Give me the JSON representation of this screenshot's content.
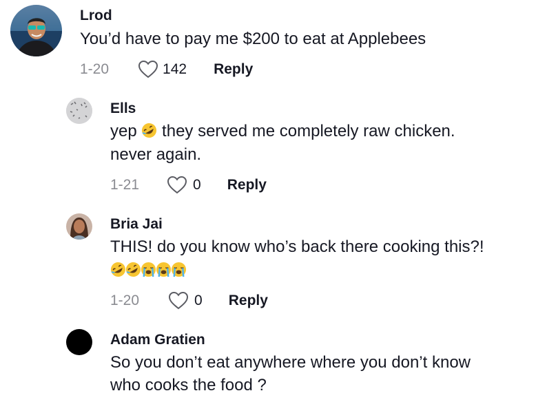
{
  "comments": [
    {
      "username": "Lrod",
      "text": "You’d have to pay me $200 to eat at Applebees",
      "date": "1-20",
      "likes": "142",
      "reply_label": "Reply"
    },
    {
      "username": "Ells",
      "text_part1": "yep",
      "text_part2": "they served me completely raw chicken.",
      "text_line2": "never again.",
      "date": "1-21",
      "likes": "0",
      "reply_label": "Reply",
      "emoji": "rolling-on-floor-laughing"
    },
    {
      "username": "Bria Jai",
      "text": "THIS! do you know who’s back there cooking this?!",
      "emojis": [
        "rolling-on-floor-laughing",
        "rolling-on-floor-laughing",
        "loudly-crying",
        "loudly-crying",
        "loudly-crying"
      ],
      "date": "1-20",
      "likes": "0",
      "reply_label": "Reply"
    },
    {
      "username": "Adam Gratien",
      "text_line1": "So you don’t eat anywhere where you don’t know",
      "text_line2": "who cooks the food ?"
    }
  ],
  "colors": {
    "text": "#161823",
    "muted": "#8a8b91",
    "emoji_face": "#f7c531"
  }
}
